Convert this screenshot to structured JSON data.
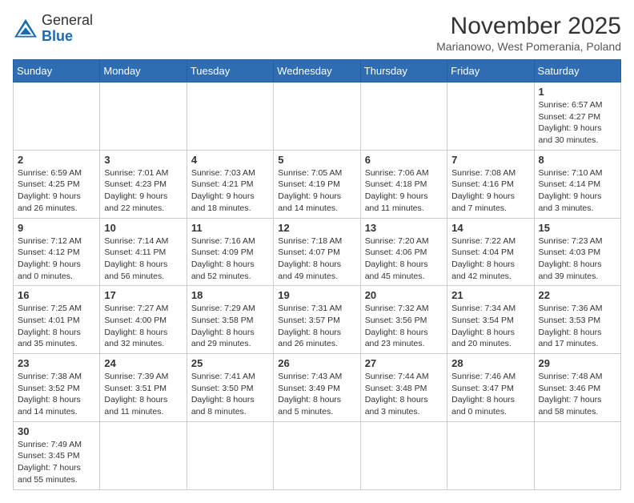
{
  "header": {
    "logo_general": "General",
    "logo_blue": "Blue",
    "month_title": "November 2025",
    "subtitle": "Marianowo, West Pomerania, Poland"
  },
  "days_of_week": [
    "Sunday",
    "Monday",
    "Tuesday",
    "Wednesday",
    "Thursday",
    "Friday",
    "Saturday"
  ],
  "weeks": [
    [
      {
        "day": "",
        "info": "",
        "empty": true
      },
      {
        "day": "",
        "info": "",
        "empty": true
      },
      {
        "day": "",
        "info": "",
        "empty": true
      },
      {
        "day": "",
        "info": "",
        "empty": true
      },
      {
        "day": "",
        "info": "",
        "empty": true
      },
      {
        "day": "",
        "info": "",
        "empty": true
      },
      {
        "day": "1",
        "info": "Sunrise: 6:57 AM\nSunset: 4:27 PM\nDaylight: 9 hours and 30 minutes.",
        "empty": false
      }
    ],
    [
      {
        "day": "2",
        "info": "Sunrise: 6:59 AM\nSunset: 4:25 PM\nDaylight: 9 hours and 26 minutes.",
        "empty": false
      },
      {
        "day": "3",
        "info": "Sunrise: 7:01 AM\nSunset: 4:23 PM\nDaylight: 9 hours and 22 minutes.",
        "empty": false
      },
      {
        "day": "4",
        "info": "Sunrise: 7:03 AM\nSunset: 4:21 PM\nDaylight: 9 hours and 18 minutes.",
        "empty": false
      },
      {
        "day": "5",
        "info": "Sunrise: 7:05 AM\nSunset: 4:19 PM\nDaylight: 9 hours and 14 minutes.",
        "empty": false
      },
      {
        "day": "6",
        "info": "Sunrise: 7:06 AM\nSunset: 4:18 PM\nDaylight: 9 hours and 11 minutes.",
        "empty": false
      },
      {
        "day": "7",
        "info": "Sunrise: 7:08 AM\nSunset: 4:16 PM\nDaylight: 9 hours and 7 minutes.",
        "empty": false
      },
      {
        "day": "8",
        "info": "Sunrise: 7:10 AM\nSunset: 4:14 PM\nDaylight: 9 hours and 3 minutes.",
        "empty": false
      }
    ],
    [
      {
        "day": "9",
        "info": "Sunrise: 7:12 AM\nSunset: 4:12 PM\nDaylight: 9 hours and 0 minutes.",
        "empty": false
      },
      {
        "day": "10",
        "info": "Sunrise: 7:14 AM\nSunset: 4:11 PM\nDaylight: 8 hours and 56 minutes.",
        "empty": false
      },
      {
        "day": "11",
        "info": "Sunrise: 7:16 AM\nSunset: 4:09 PM\nDaylight: 8 hours and 52 minutes.",
        "empty": false
      },
      {
        "day": "12",
        "info": "Sunrise: 7:18 AM\nSunset: 4:07 PM\nDaylight: 8 hours and 49 minutes.",
        "empty": false
      },
      {
        "day": "13",
        "info": "Sunrise: 7:20 AM\nSunset: 4:06 PM\nDaylight: 8 hours and 45 minutes.",
        "empty": false
      },
      {
        "day": "14",
        "info": "Sunrise: 7:22 AM\nSunset: 4:04 PM\nDaylight: 8 hours and 42 minutes.",
        "empty": false
      },
      {
        "day": "15",
        "info": "Sunrise: 7:23 AM\nSunset: 4:03 PM\nDaylight: 8 hours and 39 minutes.",
        "empty": false
      }
    ],
    [
      {
        "day": "16",
        "info": "Sunrise: 7:25 AM\nSunset: 4:01 PM\nDaylight: 8 hours and 35 minutes.",
        "empty": false
      },
      {
        "day": "17",
        "info": "Sunrise: 7:27 AM\nSunset: 4:00 PM\nDaylight: 8 hours and 32 minutes.",
        "empty": false
      },
      {
        "day": "18",
        "info": "Sunrise: 7:29 AM\nSunset: 3:58 PM\nDaylight: 8 hours and 29 minutes.",
        "empty": false
      },
      {
        "day": "19",
        "info": "Sunrise: 7:31 AM\nSunset: 3:57 PM\nDaylight: 8 hours and 26 minutes.",
        "empty": false
      },
      {
        "day": "20",
        "info": "Sunrise: 7:32 AM\nSunset: 3:56 PM\nDaylight: 8 hours and 23 minutes.",
        "empty": false
      },
      {
        "day": "21",
        "info": "Sunrise: 7:34 AM\nSunset: 3:54 PM\nDaylight: 8 hours and 20 minutes.",
        "empty": false
      },
      {
        "day": "22",
        "info": "Sunrise: 7:36 AM\nSunset: 3:53 PM\nDaylight: 8 hours and 17 minutes.",
        "empty": false
      }
    ],
    [
      {
        "day": "23",
        "info": "Sunrise: 7:38 AM\nSunset: 3:52 PM\nDaylight: 8 hours and 14 minutes.",
        "empty": false
      },
      {
        "day": "24",
        "info": "Sunrise: 7:39 AM\nSunset: 3:51 PM\nDaylight: 8 hours and 11 minutes.",
        "empty": false
      },
      {
        "day": "25",
        "info": "Sunrise: 7:41 AM\nSunset: 3:50 PM\nDaylight: 8 hours and 8 minutes.",
        "empty": false
      },
      {
        "day": "26",
        "info": "Sunrise: 7:43 AM\nSunset: 3:49 PM\nDaylight: 8 hours and 5 minutes.",
        "empty": false
      },
      {
        "day": "27",
        "info": "Sunrise: 7:44 AM\nSunset: 3:48 PM\nDaylight: 8 hours and 3 minutes.",
        "empty": false
      },
      {
        "day": "28",
        "info": "Sunrise: 7:46 AM\nSunset: 3:47 PM\nDaylight: 8 hours and 0 minutes.",
        "empty": false
      },
      {
        "day": "29",
        "info": "Sunrise: 7:48 AM\nSunset: 3:46 PM\nDaylight: 7 hours and 58 minutes.",
        "empty": false
      }
    ],
    [
      {
        "day": "30",
        "info": "Sunrise: 7:49 AM\nSunset: 3:45 PM\nDaylight: 7 hours and 55 minutes.",
        "empty": false
      },
      {
        "day": "",
        "info": "",
        "empty": true
      },
      {
        "day": "",
        "info": "",
        "empty": true
      },
      {
        "day": "",
        "info": "",
        "empty": true
      },
      {
        "day": "",
        "info": "",
        "empty": true
      },
      {
        "day": "",
        "info": "",
        "empty": true
      },
      {
        "day": "",
        "info": "",
        "empty": true
      }
    ]
  ]
}
